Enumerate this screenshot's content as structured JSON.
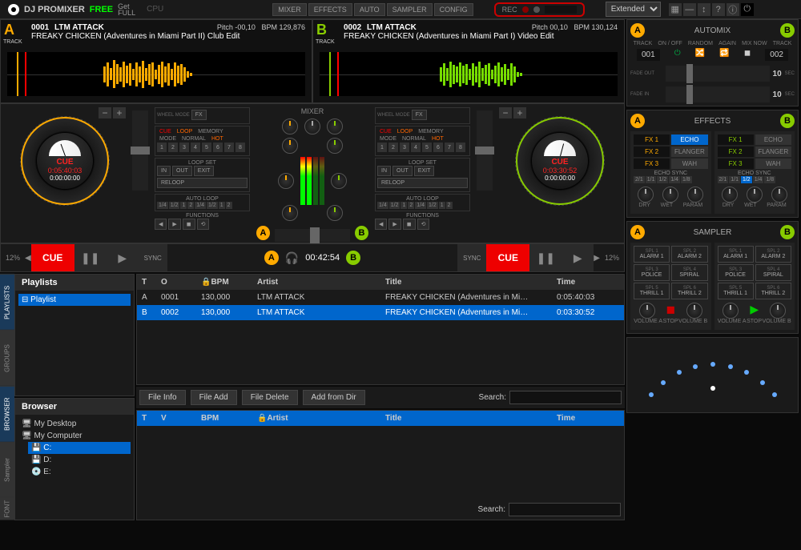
{
  "app": {
    "title": "DJ PROMIXER",
    "free": "FREE",
    "getfull_l1": "Get",
    "getfull_l2": "FULL",
    "cpu": "CPU"
  },
  "topnav": {
    "mixer": "MIXER",
    "effects": "EFFECTS",
    "auto": "AUTO",
    "sampler": "SAMPLER",
    "config": "CONFIG"
  },
  "rec": {
    "label": "REC"
  },
  "layout": {
    "selected": "Extended"
  },
  "deckA": {
    "letter": "A",
    "track_label": "TRACK",
    "num": "0001",
    "artist": "LTM ATTACK",
    "title": "FREAKY CHICKEN (Adventures in Miami Part II) Club Edit",
    "pitch": "Pitch -00,10",
    "bpm": "BPM 129,876",
    "cue": "CUE",
    "time": "0:05:40:03",
    "time2": "0:00:00:00"
  },
  "deckB": {
    "letter": "B",
    "track_label": "TRACK",
    "num": "0002",
    "artist": "LTM ATTACK",
    "title": "FREAKY CHICKEN (Adventures in Miami Part I) Video Edit",
    "pitch": "Pitch 00,10",
    "bpm": "BPM 130,124",
    "cue": "CUE",
    "time": "0:03:30:52",
    "time2": "0:00:00:00"
  },
  "ctrl": {
    "wheel_mode": "WHEEL MODE",
    "fx": "FX",
    "cue_l": "CUE",
    "loop": "LOOP",
    "memory": "MEMORY",
    "mode": "MODE",
    "normal": "NORMAL",
    "hot": "HOT",
    "loop_set": "LOOP SET",
    "in": "IN",
    "out": "OUT",
    "exit": "EXIT",
    "reloop": "RELOOP",
    "auto_loop": "AUTO LOOP",
    "functions": "FUNCTIONS",
    "sync": "SYNC"
  },
  "mixer": {
    "label": "MIXER",
    "time": "00:42:54"
  },
  "transport": {
    "cue": "CUE",
    "pct": "12%"
  },
  "sidebar": {
    "playlists": "Playlists",
    "playlist_item": "Playlist",
    "browser": "Browser",
    "desktop": "My Desktop",
    "computer": "My Computer",
    "c": "C:",
    "d": "D:",
    "e": "E:",
    "tab_playlists": "PLAYLISTS",
    "tab_groups": "GROUPS",
    "tab_browser": "BROWSER",
    "tab_samples": "Sampler",
    "font": "FONT"
  },
  "table": {
    "cols": {
      "t": "T",
      "o": "O",
      "v": "V",
      "bpm": "BPM",
      "artist": "Artist",
      "title": "Title",
      "time": "Time"
    },
    "rows": [
      {
        "t": "A",
        "o": "0001",
        "bpm": "130,000",
        "artist": "LTM ATTACK",
        "title": "FREAKY CHICKEN (Adventures in Mi…",
        "time": "0:05:40:03"
      },
      {
        "t": "B",
        "o": "0002",
        "bpm": "130,000",
        "artist": "LTM ATTACK",
        "title": "FREAKY CHICKEN (Adventures in Mi…",
        "time": "0:03:30:52"
      }
    ],
    "search": "Search:"
  },
  "actions": {
    "fileinfo": "File Info",
    "fileadd": "File Add",
    "filedel": "File Delete",
    "addfromdir": "Add from Dir"
  },
  "automix": {
    "title": "AUTOMIX",
    "track": "TRACK",
    "onoff": "ON / OFF",
    "random": "RANDOM",
    "again": "AGAIN",
    "mixnow": "MIX NOW",
    "t1": "001",
    "t2": "002",
    "fadeout": "FADE OUT",
    "fadein": "FADE IN",
    "val": "10",
    "sec": "SEC"
  },
  "effects": {
    "title": "EFFECTS",
    "fx1": "FX 1",
    "fx2": "FX 2",
    "fx3": "FX 3",
    "echo": "ECHO",
    "flanger": "FLANGER",
    "wah": "WAH",
    "echosync": "ECHO SYNC",
    "dry": "DRY",
    "wet": "WET",
    "param": "PARAM"
  },
  "sampler": {
    "title": "SAMPLER",
    "pads": [
      "ALARM 1",
      "ALARM 2",
      "POLICE",
      "SPIRAL",
      "THRILL 1",
      "THRILL 2"
    ],
    "spl_lbl": [
      "SPL 1",
      "SPL 2",
      "SPL 3",
      "SPL 4",
      "SPL 5",
      "SPL 6"
    ],
    "vol": "VOLUME",
    "stop": "STOP"
  },
  "fractions": [
    "1/4",
    "1/2",
    "1",
    "2",
    "1/4",
    "1/2",
    "1",
    "2"
  ],
  "numbtns": [
    "1",
    "2",
    "3",
    "4",
    "5",
    "6",
    "7",
    "8"
  ]
}
